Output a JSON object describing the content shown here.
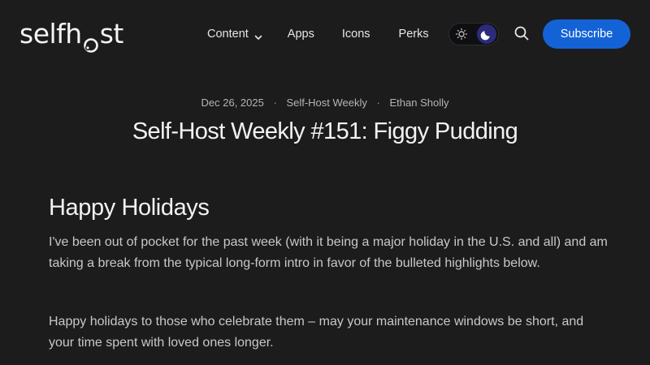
{
  "header": {
    "logo": {
      "left": "selfh",
      "right": "st"
    },
    "nav": {
      "content_label": "Content",
      "apps_label": "Apps",
      "icons_label": "Icons",
      "perks_label": "Perks"
    },
    "theme_toggle": {
      "mode": "dark",
      "light_icon": "sun-icon",
      "dark_icon": "moon-icon"
    },
    "search_icon": "search-icon",
    "subscribe_label": "Subscribe"
  },
  "article": {
    "date": "Dec 26, 2025",
    "separator": "·",
    "category": "Self-Host Weekly",
    "author": "Ethan Sholly",
    "title": "Self-Host Weekly #151: Figgy Pudding",
    "section_heading": "Happy Holidays",
    "paragraphs": [
      "I've been out of pocket for the past week (with it being a major holiday in the U.S. and all) and am taking a break from the typical long-form intro in favor of the bulleted highlights below.",
      "Happy holidays to those who celebrate them – may your maintenance windows be short, and your time spent with loved ones longer."
    ]
  },
  "colors": {
    "background": "#1c1c1d",
    "accent": "#1463d6",
    "toggle_active": "#2b2b7a"
  }
}
